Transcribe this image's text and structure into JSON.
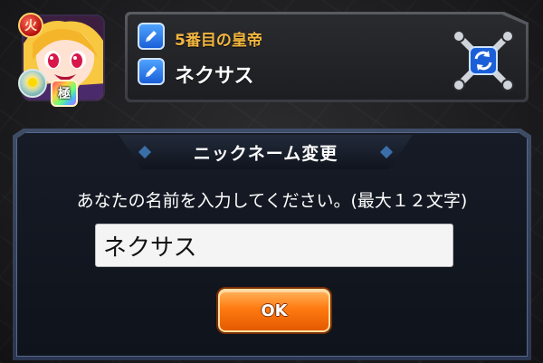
{
  "header": {
    "avatar": {
      "attribute_badge": "火",
      "rank_badge": "極",
      "skill_icon": "sparkle-orb-icon"
    },
    "title_text": "5番目の皇帝",
    "nickname_text": "ネクサス",
    "edit_icon": "pencil-icon",
    "refresh_icon": "refresh-icon"
  },
  "dialog": {
    "title": "ニックネーム変更",
    "prompt": "あなたの名前を入力してください。(最大１２文字)",
    "input_value": "ネクサス",
    "ok_label": "OK"
  },
  "colors": {
    "title_gold": "#f2b640",
    "ok_orange": "#ff7a12",
    "edit_blue": "#1a5fd8"
  }
}
